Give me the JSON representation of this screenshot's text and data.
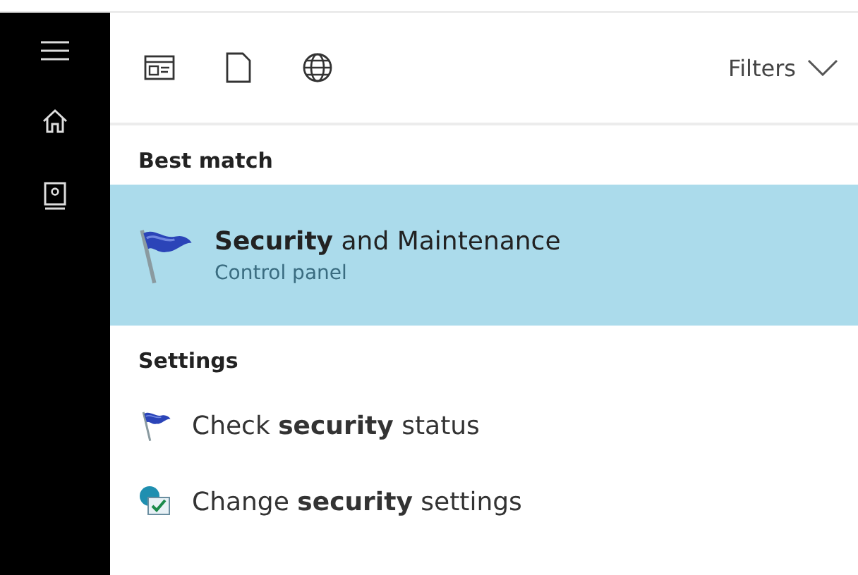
{
  "toolbar": {
    "filters_label": "Filters"
  },
  "sections": [
    {
      "heading": "Best match",
      "items": [
        {
          "kind": "large",
          "title": "**Security** and Maintenance",
          "subtitle": "Control panel",
          "selected": true
        }
      ]
    },
    {
      "heading": "Settings",
      "items": [
        {
          "kind": "small",
          "title": "Check **security** status",
          "selected": false
        },
        {
          "kind": "small",
          "title": "Change **security** settings",
          "selected": false
        }
      ]
    }
  ]
}
